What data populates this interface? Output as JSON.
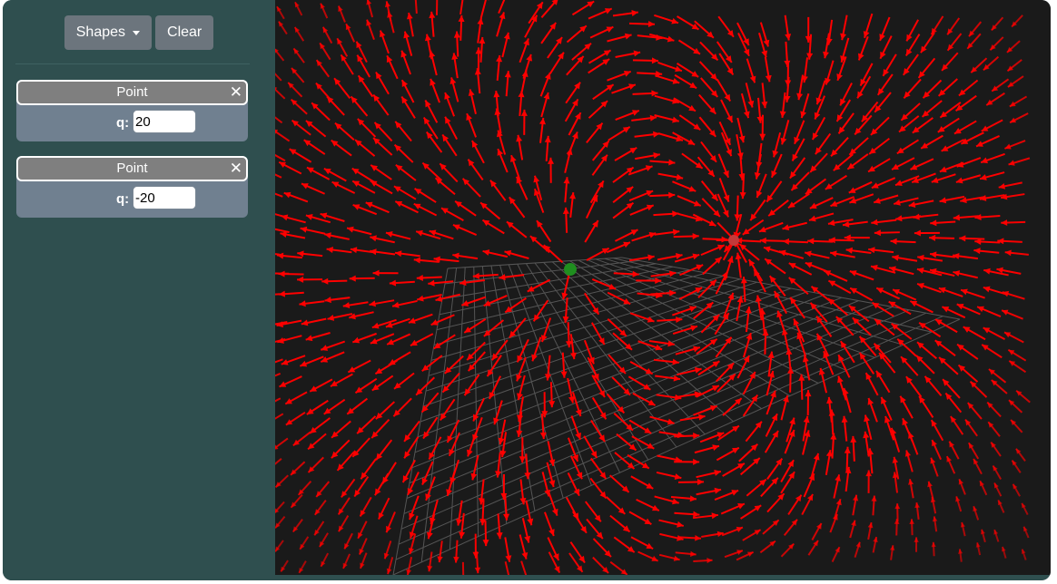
{
  "toolbar": {
    "shapes_label": "Shapes",
    "clear_label": "Clear"
  },
  "shapes": [
    {
      "title": "Point",
      "q_label": "q:",
      "q_value": "20"
    },
    {
      "title": "Point",
      "q_label": "q:",
      "q_value": "-20"
    }
  ],
  "scene": {
    "background": "#1a1a1a",
    "grid_color": "#555555",
    "field_arrow_color": "#ff0000",
    "far_arrow_color": "#4a9a98",
    "positive_charge_color": "#1f8f1f",
    "negative_charge_color": "#c43a3a"
  }
}
